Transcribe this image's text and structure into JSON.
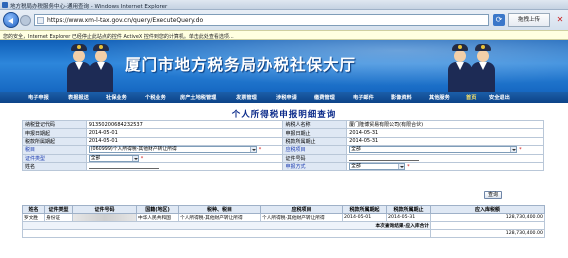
{
  "window": {
    "title": "地方税局办税服务中心-通用查询 - Windows Internet Explorer"
  },
  "address": {
    "url": "https://www.xm-l-tax.gov.cn/query/ExecuteQuery.do",
    "upload_label": "拖拽上传",
    "close_glyph": "✕"
  },
  "infobar": {
    "text": "您的安全，Internet Explorer 已经停止此站点的控件 ActiveX 控件到您的计算机。单击此处查看选项..."
  },
  "banner": {
    "title": "厦门市地方税务局办税社保大厅"
  },
  "nav": {
    "items": [
      "电子申报",
      "表报报送",
      "社保业务",
      "个税业务",
      "房产土地税管理",
      "发票管理",
      "涉税申请",
      "缴费管理",
      "电子邮件",
      "影像资料",
      "其他服务",
      "首页",
      "安全退出"
    ]
  },
  "page": {
    "title": "个人所得税申报明细查询"
  },
  "form": {
    "rows": [
      {
        "l1": "纳税登记代码",
        "v1": "91350200684232537",
        "l2": "纳税人名称",
        "v2": "厦门隆博贸易有限公司(有限合伙)"
      },
      {
        "l1": "申报日期起",
        "v1": "2014-05-01",
        "l2": "申报日期止",
        "v2": "2014-05-31"
      },
      {
        "l1": "税款所属期起",
        "v1": "2014-05-01",
        "l2": "税款所属期止",
        "v2": "2014-05-31"
      },
      {
        "l1": "税目",
        "v1": "(060999)个人所得税-其他财产转让所得",
        "l2": "应税项目",
        "v2": "全部"
      },
      {
        "l1": "证件类型",
        "v1": "全部",
        "l2": "证件号码",
        "v2": ""
      },
      {
        "l1": "姓名",
        "v1": "",
        "l2": "申报方式",
        "v2": "全部"
      }
    ],
    "query_label": "查询"
  },
  "results": {
    "headers": [
      "姓名",
      "证件类型",
      "证件号码",
      "国籍(地区)",
      "税种、税目",
      "应税项目",
      "税款所属期起",
      "税款所属期止",
      "应入库税额"
    ],
    "rows": [
      [
        "罗文胜",
        "身份证",
        "",
        "中华人民共和国",
        "个人所得税-其他财产转让所得",
        "个人所得税-其他财产转让所得",
        "2014-05-01",
        "2014-05-31",
        "128,730,400.00"
      ]
    ],
    "summary_label": "本次查询结果-应入库合计",
    "summary_value": "128,730,400.00"
  }
}
